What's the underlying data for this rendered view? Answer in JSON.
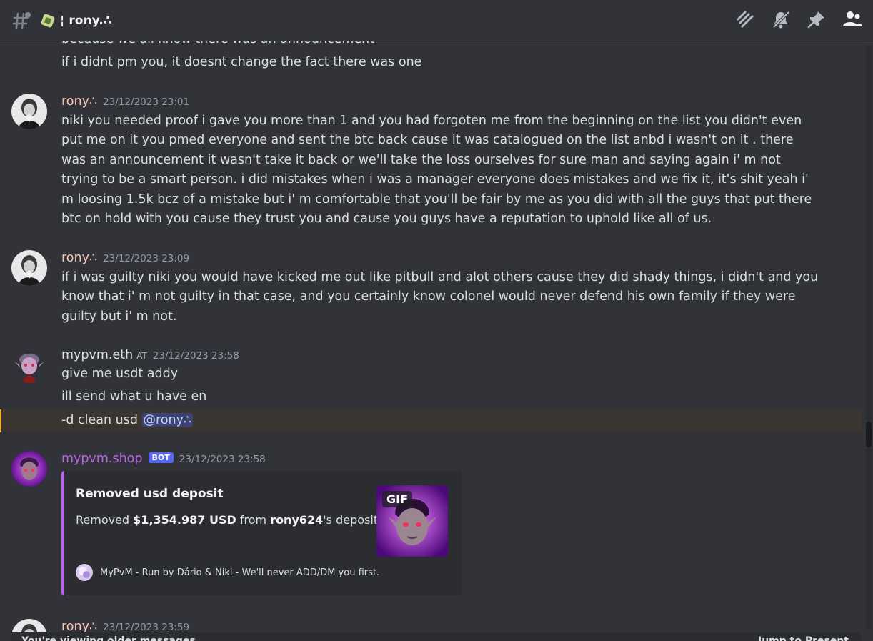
{
  "header": {
    "channel_name": "¦ rony.∴"
  },
  "messages": {
    "cut_line": "because we all know there was an announcement",
    "line2": "if i didnt pm you, it doesnt change the fact there was one",
    "m1": {
      "username": "rony∴",
      "timestamp": "23/12/2023 23:01",
      "text": "niki you needed proof i gave you more than 1 and you had forgoten me from the beginning on the list you didn't even put me on it you pmed everyone and sent the btc back cause it was catalogued on the list anbd i wasn't on it . there was an announcement it wasn't take it back or we'll take the loss ourselves for sure man and saying again i' m not trying to be a smart person. i did mistakes when i was a manager everyone does mistakes and we fix it, it's shit yeah i' m loosing 1.5k bcz of a mistake but i' m comfortable that you'll be fair by me as you did with all the guys that put there btc on hold with you cause they trust you and  cause you guys have a reputation to uphold like all of us."
    },
    "m2": {
      "username": "rony∴",
      "timestamp": "23/12/2023 23:09",
      "text": "if i was guilty niki you would have kicked me out like pitbull and alot others cause they did shady things, i didn't and you know that i' m not guilty in that case, and you certainly know colonel would never defend his own family if they were guilty but i' m not."
    },
    "m3": {
      "username": "mypvm.eth",
      "tag": "AT",
      "timestamp": "23/12/2023 23:58",
      "line1": "give me usdt addy",
      "line2": "ill send what u have en",
      "line3": "-d clean usd",
      "mention": "@rony∴"
    },
    "m4": {
      "username": "mypvm.shop",
      "badge": "BOT",
      "timestamp": "23/12/2023 23:58",
      "embed": {
        "title": "Removed usd deposit",
        "desc_prefix": "Removed ",
        "amount": "$1,354.987 USD",
        "desc_mid": " from ",
        "user": "rony624",
        "desc_suffix": "'s deposit",
        "gif_label": "GIF",
        "footer": "MyPvM - Run by Dário & Niki - We'll never ADD/DM you first."
      }
    },
    "m5": {
      "username": "rony∴",
      "timestamp": "23/12/2023 23:59"
    }
  },
  "bottom": {
    "left": "You're viewing older messages",
    "right": "Jump to Present"
  },
  "colors": {
    "rony_name": "#f9c4b2",
    "eth_name": "#dbdee1",
    "shop_name": "#b865e8",
    "accent": "#5865f2"
  }
}
